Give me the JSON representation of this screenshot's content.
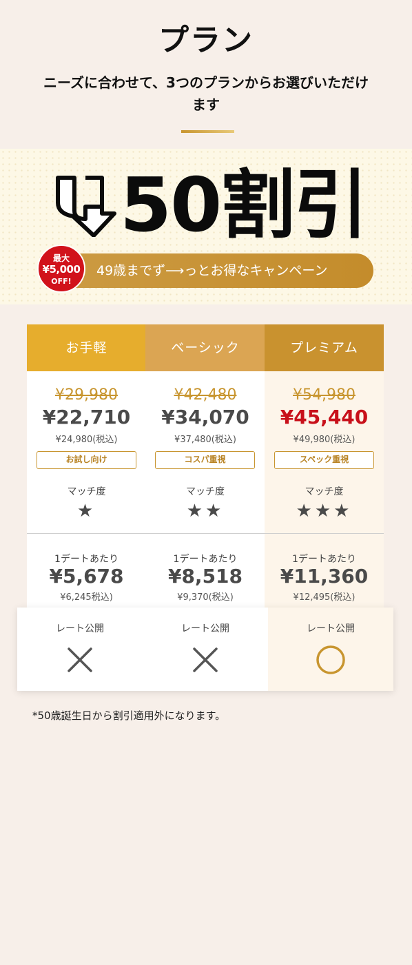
{
  "header": {
    "title": "プラン",
    "subtitle": "ニーズに合わせて、3つのプランからお選びいただけます"
  },
  "banner": {
    "headline": "50割引",
    "icon": "u-down-arrow-icon",
    "badge_line1": "最大",
    "badge_line2": "¥5,000",
    "badge_line3": "OFF!",
    "campaign": "49歳までず⟶っとお得なキャンペーン"
  },
  "plans": [
    {
      "name": "お手軽",
      "original_price": "¥29,980",
      "price": "¥22,710",
      "tax_price": "¥24,980(税込)",
      "tag": "お試し向け",
      "match_label": "マッチ度",
      "stars": "★",
      "star_count": 1,
      "per_date_label": "1デートあたり",
      "per_date_price": "¥5,678",
      "per_date_tax": "¥6,245税込)",
      "rate_label": "レート公開",
      "rate_public": false
    },
    {
      "name": "ベーシック",
      "original_price": "¥42,480",
      "price": "¥34,070",
      "tax_price": "¥37,480(税込)",
      "tag": "コスパ重視",
      "match_label": "マッチ度",
      "stars": "★★",
      "star_count": 2,
      "per_date_label": "1デートあたり",
      "per_date_price": "¥8,518",
      "per_date_tax": "¥9,370(税込)",
      "rate_label": "レート公開",
      "rate_public": false
    },
    {
      "name": "プレミアム",
      "original_price": "¥54,980",
      "price": "¥45,440",
      "tax_price": "¥49,980(税込)",
      "tag": "スペック重視",
      "match_label": "マッチ度",
      "stars": "★★★",
      "star_count": 3,
      "per_date_label": "1デートあたり",
      "per_date_price": "¥11,360",
      "per_date_tax": "¥12,495(税込)",
      "rate_label": "レート公開",
      "rate_public": true
    }
  ],
  "footnote": "*50歳誕生日から割引適用外になります。",
  "colors": {
    "background": "#f7efe9",
    "header_col1": "#e6ad2d",
    "header_col2": "#dba553",
    "header_col3": "#c9922f",
    "premium_bg": "#fdf5ea",
    "gold": "#c8952f",
    "sale_red": "#c8101a"
  }
}
